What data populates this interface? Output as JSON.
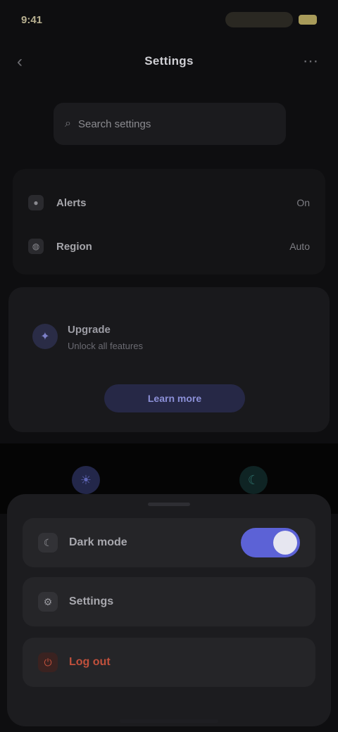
{
  "status_bar": {
    "time": "9:41"
  },
  "nav": {
    "title": "Settings",
    "back_glyph": "‹",
    "menu_glyph": "⋯"
  },
  "search": {
    "placeholder": "Search settings"
  },
  "info_rows": [
    {
      "icon": "bell-icon",
      "glyph": "●",
      "label": "Alerts",
      "value": "On"
    },
    {
      "icon": "globe-icon",
      "glyph": "◍",
      "label": "Region",
      "value": "Auto"
    }
  ],
  "promo": {
    "avatar_glyph": "✦",
    "title": "Upgrade",
    "subtitle": "Unlock all features",
    "button_label": "Learn more"
  },
  "mode_switch": {
    "light_glyph": "☀",
    "dark_glyph": "☾"
  },
  "sheet": {
    "items": [
      {
        "icon": "moon-icon",
        "glyph": "☾",
        "label": "Dark mode"
      },
      {
        "icon": "gear-icon",
        "glyph": "⚙",
        "label": "Settings"
      },
      {
        "icon": "logout-icon",
        "glyph": "⏻",
        "label": "Log out"
      }
    ]
  },
  "colors": {
    "background": "#0e0e10",
    "accent": "#5c62d6",
    "danger": "#c0503c"
  }
}
